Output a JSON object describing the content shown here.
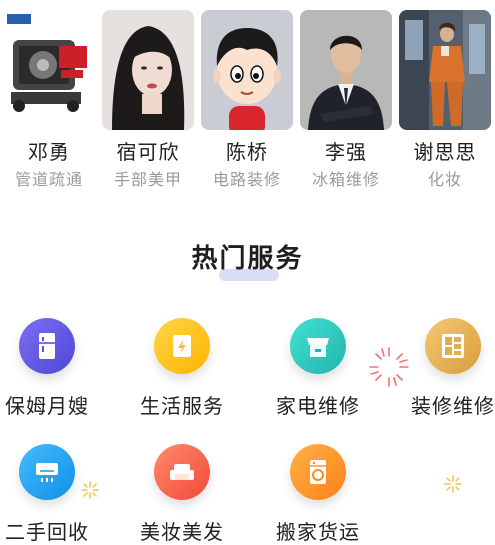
{
  "providers": [
    {
      "name": "邓勇",
      "tag": "管道疏通",
      "photo": "pipe-machine-photo"
    },
    {
      "name": "宿可欣",
      "tag": "手部美甲",
      "photo": "woman-portrait-photo"
    },
    {
      "name": "陈桥",
      "tag": "电路装修",
      "photo": "cartoon-avatar-photo"
    },
    {
      "name": "李强",
      "tag": "冰箱维修",
      "photo": "man-suit-photo"
    },
    {
      "name": "谢思思",
      "tag": "化妆",
      "photo": "woman-street-photo"
    }
  ],
  "section": {
    "title": "热门服务"
  },
  "services": [
    {
      "label": "保姆月嫂",
      "icon": "fridge-icon",
      "color": "#6a5ae0"
    },
    {
      "label": "生活服务",
      "icon": "lightning-card-icon",
      "color": "#ffc61a"
    },
    {
      "label": "家电维修",
      "icon": "store-icon",
      "color": "#34d1c4"
    },
    {
      "label": "装修维修",
      "icon": "wall-panel-icon",
      "color": "#e8b75b"
    },
    {
      "label": "二手回收",
      "icon": "air-conditioner-icon",
      "color": "#1ea4f5"
    },
    {
      "label": "美妆美发",
      "icon": "sofa-icon",
      "color": "#ff6a4d"
    },
    {
      "label": "搬家货运",
      "icon": "washing-machine-icon",
      "color": "#ff9a2b"
    }
  ]
}
